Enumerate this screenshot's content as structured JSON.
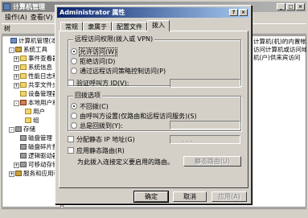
{
  "mmc": {
    "title": "计算机管理",
    "menu": [
      "操作(A)",
      "查看(V)"
    ],
    "tab": "树",
    "tree": [
      {
        "label": "计算机管理(本地)",
        "indent": 0,
        "icon": "computer-icon",
        "exp": ""
      },
      {
        "label": "系统工具",
        "indent": 1,
        "icon": "tools-icon",
        "exp": "-"
      },
      {
        "label": "事件查看器",
        "indent": 2,
        "icon": "folder-icon",
        "exp": "+"
      },
      {
        "label": "系统信息",
        "indent": 2,
        "icon": "folder-icon",
        "exp": "+"
      },
      {
        "label": "性能日志和",
        "indent": 2,
        "icon": "folder-icon",
        "exp": "+"
      },
      {
        "label": "共享文件夹",
        "indent": 2,
        "icon": "folder-icon",
        "exp": "+"
      },
      {
        "label": "设备管理器",
        "indent": 2,
        "icon": "folder-icon",
        "exp": ""
      },
      {
        "label": "本地用户和",
        "indent": 2,
        "icon": "users-icon",
        "exp": "-"
      },
      {
        "label": "用户",
        "indent": 3,
        "icon": "folder-icon",
        "exp": ""
      },
      {
        "label": "组",
        "indent": 3,
        "icon": "folder-icon",
        "exp": ""
      },
      {
        "label": "存储",
        "indent": 1,
        "icon": "disk-icon",
        "exp": "-"
      },
      {
        "label": "磁盘管理",
        "indent": 2,
        "icon": "disk-icon",
        "exp": ""
      },
      {
        "label": "磁盘碎片整",
        "indent": 2,
        "icon": "disk-icon",
        "exp": ""
      },
      {
        "label": "逻辑驱动器",
        "indent": 2,
        "icon": "disk-icon",
        "exp": ""
      },
      {
        "label": "可移动存储",
        "indent": 2,
        "icon": "disk-icon",
        "exp": "+"
      },
      {
        "label": "服务和应用程序",
        "indent": 1,
        "icon": "tools-icon",
        "exp": "+"
      }
    ],
    "right_text": [
      "计算机(机)的内置帐",
      "访问计算机或访问域",
      "机(户)供来宾访问"
    ]
  },
  "dialog": {
    "title": "Administrator 属性",
    "tabs": [
      "常规",
      "隶属于",
      "配置文件",
      "拨入"
    ],
    "active_tab": "拨入",
    "remote_access_group": "远程访问权限(拨入或 VPN)",
    "radio_allow": "允许访问(W)",
    "radio_deny": "拒绝访问(D)",
    "radio_policy": "通过远程访问策略控制访问(P)",
    "verify_caller_id": "验证呼叫方 ID(V):",
    "callback_group": "回拨选项",
    "cb_none": "不回拨(C)",
    "cb_caller": "由呼叫方设置(仅路由和远程访问服务)(S)",
    "cb_always": "总是回拨到(Y):",
    "static_ip": "分配静态 IP 地址(G)",
    "static_routes": "应用静态路由(R)",
    "routes_desc": "为此拨入连接定义要启用的路由。",
    "static_routes_btn": "静态路由(U)",
    "ok": "确定",
    "cancel": "取消",
    "apply": "应用(A)",
    "ip_placeholder": ". . ."
  }
}
